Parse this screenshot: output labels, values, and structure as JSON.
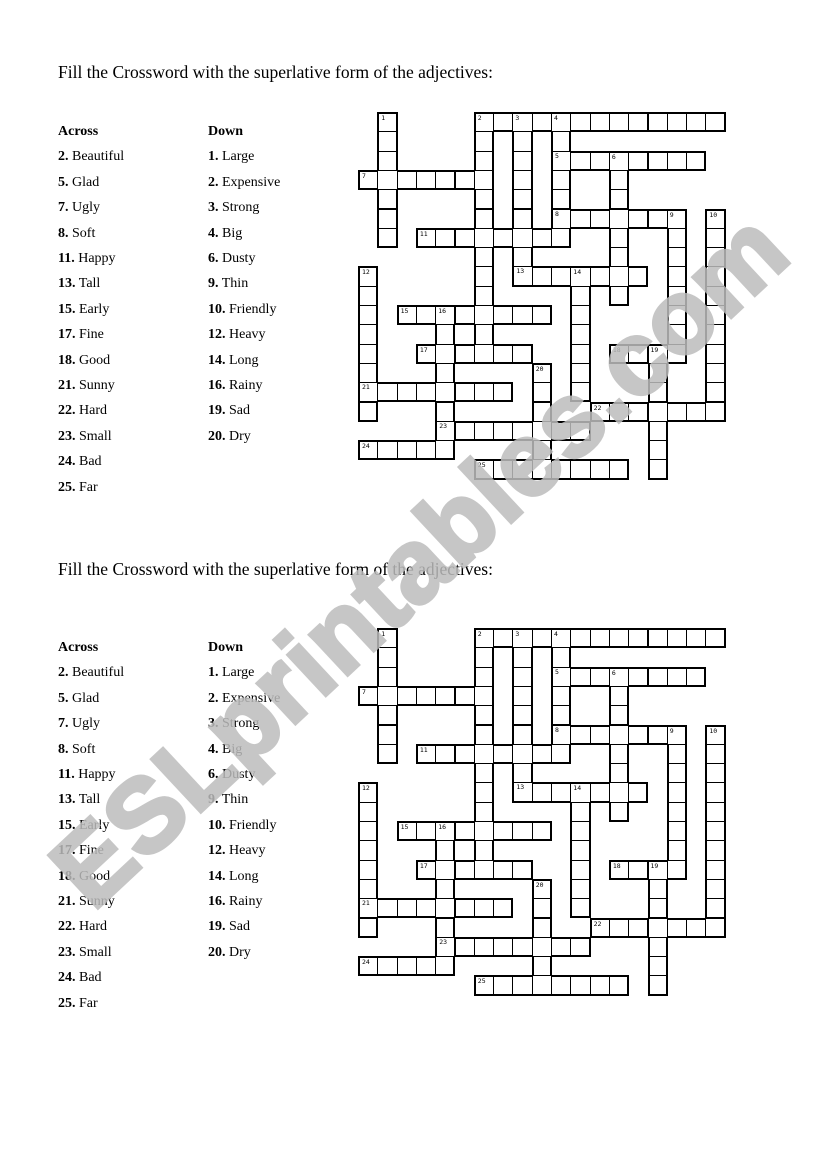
{
  "worksheets": [
    {
      "heading": "Fill the Crossword with the superlative form of the adjectives:",
      "across_header": "Across",
      "down_header": "Down"
    },
    {
      "heading": "Fill the Crossword with the superlative form of the adjectives:",
      "across_header": "Across",
      "down_header": "Down"
    }
  ],
  "clues": {
    "across": [
      {
        "num": "2.",
        "text": "Beautiful"
      },
      {
        "num": "5.",
        "text": "Glad"
      },
      {
        "num": "7.",
        "text": "Ugly"
      },
      {
        "num": "8.",
        "text": "Soft"
      },
      {
        "num": "11.",
        "text": "Happy"
      },
      {
        "num": "13.",
        "text": "Tall"
      },
      {
        "num": "15.",
        "text": "Early"
      },
      {
        "num": "17.",
        "text": "Fine"
      },
      {
        "num": "18.",
        "text": "Good"
      },
      {
        "num": "21.",
        "text": "Sunny"
      },
      {
        "num": "22.",
        "text": "Hard"
      },
      {
        "num": "23.",
        "text": "Small"
      },
      {
        "num": "24.",
        "text": "Bad"
      },
      {
        "num": "25.",
        "text": "Far"
      }
    ],
    "down": [
      {
        "num": "1.",
        "text": "Large"
      },
      {
        "num": "2.",
        "text": "Expensive"
      },
      {
        "num": "3.",
        "text": "Strong"
      },
      {
        "num": "4.",
        "text": "Big"
      },
      {
        "num": "6.",
        "text": "Dusty"
      },
      {
        "num": "9.",
        "text": "Thin"
      },
      {
        "num": "10.",
        "text": "Friendly"
      },
      {
        "num": "12.",
        "text": "Heavy"
      },
      {
        "num": "14.",
        "text": "Long"
      },
      {
        "num": "16.",
        "text": "Rainy"
      },
      {
        "num": "19.",
        "text": "Sad"
      },
      {
        "num": "20.",
        "text": "Dry"
      }
    ]
  },
  "puzzle": {
    "words": [
      {
        "num": 2,
        "dir": "across",
        "row": 0,
        "col": 6,
        "len": 13
      },
      {
        "num": 5,
        "dir": "across",
        "row": 2,
        "col": 10,
        "len": 8
      },
      {
        "num": 7,
        "dir": "across",
        "row": 3,
        "col": 0,
        "len": 7
      },
      {
        "num": 8,
        "dir": "across",
        "row": 5,
        "col": 10,
        "len": 7
      },
      {
        "num": 11,
        "dir": "across",
        "row": 6,
        "col": 3,
        "len": 8
      },
      {
        "num": 13,
        "dir": "across",
        "row": 8,
        "col": 8,
        "len": 7
      },
      {
        "num": 15,
        "dir": "across",
        "row": 10,
        "col": 2,
        "len": 8
      },
      {
        "num": 17,
        "dir": "across",
        "row": 12,
        "col": 3,
        "len": 6
      },
      {
        "num": 18,
        "dir": "across",
        "row": 12,
        "col": 13,
        "len": 4
      },
      {
        "num": 21,
        "dir": "across",
        "row": 14,
        "col": 0,
        "len": 8
      },
      {
        "num": 22,
        "dir": "across",
        "row": 15,
        "col": 12,
        "len": 7
      },
      {
        "num": 23,
        "dir": "across",
        "row": 16,
        "col": 4,
        "len": 8
      },
      {
        "num": 24,
        "dir": "across",
        "row": 17,
        "col": 0,
        "len": 5
      },
      {
        "num": 25,
        "dir": "across",
        "row": 18,
        "col": 6,
        "len": 8
      },
      {
        "num": 1,
        "dir": "down",
        "row": 0,
        "col": 1,
        "len": 7
      },
      {
        "num": 2,
        "dir": "down",
        "row": 0,
        "col": 6,
        "len": 13
      },
      {
        "num": 3,
        "dir": "down",
        "row": 0,
        "col": 8,
        "len": 9
      },
      {
        "num": 4,
        "dir": "down",
        "row": 0,
        "col": 10,
        "len": 7
      },
      {
        "num": 6,
        "dir": "down",
        "row": 2,
        "col": 13,
        "len": 8
      },
      {
        "num": 9,
        "dir": "down",
        "row": 5,
        "col": 16,
        "len": 8
      },
      {
        "num": 10,
        "dir": "down",
        "row": 5,
        "col": 18,
        "len": 11
      },
      {
        "num": 12,
        "dir": "down",
        "row": 8,
        "col": 0,
        "len": 8
      },
      {
        "num": 14,
        "dir": "down",
        "row": 8,
        "col": 11,
        "len": 7
      },
      {
        "num": 16,
        "dir": "down",
        "row": 10,
        "col": 4,
        "len": 8
      },
      {
        "num": 19,
        "dir": "down",
        "row": 12,
        "col": 15,
        "len": 7
      },
      {
        "num": 20,
        "dir": "down",
        "row": 13,
        "col": 9,
        "len": 6
      }
    ]
  },
  "watermark": "ESLprintables.com"
}
